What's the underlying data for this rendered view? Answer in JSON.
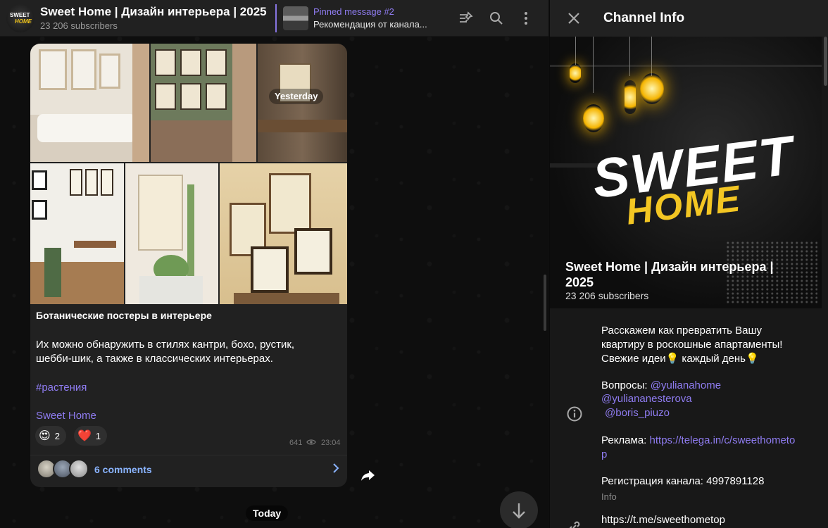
{
  "header": {
    "title": "Sweet Home | Дизайн интерьера | 2025",
    "subscribers": "23 206 subscribers",
    "pinned_label": "Pinned message #2",
    "pinned_text": "Рекомендация от канала..."
  },
  "message": {
    "date_badge": "Yesterday",
    "title": "Ботанические постеры в интерьере",
    "body": "Их можно обнаружить в стилях кантри, бохо, рустик, шебби-шик, а также в классических интерьерах.",
    "hashtag": "#растения",
    "signature": "Sweet Home",
    "reactions": [
      {
        "emoji": "😍",
        "count": "2"
      },
      {
        "emoji": "❤️",
        "count": "1"
      }
    ],
    "views": "641",
    "time": "23:04",
    "comments_label": "6 comments"
  },
  "today_badge": "Today",
  "info_panel": {
    "title": "Channel Info",
    "cover_logo_top": "SWEET",
    "cover_logo_bottom": "HOME",
    "channel_name": "Sweet Home | Дизайн интерьера | 2025",
    "subscribers": "23 206 subscribers",
    "about_1": "Расскажем как превратить Вашу квартиру в роскошные апартаменты!",
    "about_2": "Свежие идеи💡 каждый день💡",
    "questions_label": "Вопросы: ",
    "questions_link_1": "@yulianahome",
    "questions_link_2": "@yuliananesterova",
    "questions_link_3": "@boris_piuzo",
    "ads_label": "Реклама: ",
    "ads_link_1": "https://telega.in/c/sweethometo",
    "ads_link_2": "p",
    "registration": "Регистрация канала: 4997891128",
    "info_caption": "Info",
    "channel_link": "https://t.me/sweethometop"
  },
  "colors": {
    "accent": "#8f7cf1",
    "comments": "#8ab4ff",
    "logo_yellow": "#f3c623"
  }
}
